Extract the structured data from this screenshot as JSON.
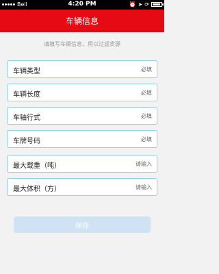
{
  "status_bar": {
    "carrier": "Bell",
    "time": "4:20 PM"
  },
  "nav": {
    "title": "车辆信息"
  },
  "hint": "请填写车辆信息，用以过滤货源",
  "fields": [
    {
      "label": "车辆类型",
      "value": "必填"
    },
    {
      "label": "车辆长度",
      "value": "必填"
    },
    {
      "label": "车轴行式",
      "value": "必填"
    },
    {
      "label": "车牌号码",
      "value": "必填"
    },
    {
      "label": "最大载重（吨）",
      "value": "请输入"
    },
    {
      "label": "最大体积（方）",
      "value": "请输入"
    }
  ],
  "save_label": "保存",
  "colors": {
    "nav_bg": "#e60a14",
    "field_border": "#8fd3df",
    "button_bg": "#cfe3f5"
  }
}
